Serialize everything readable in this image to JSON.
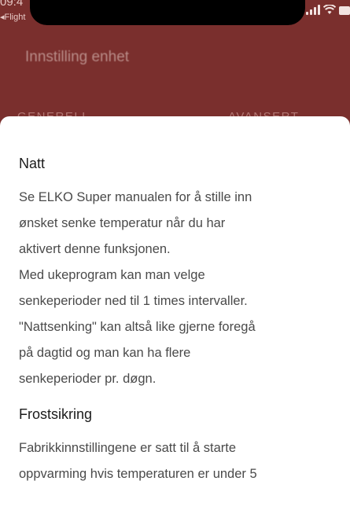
{
  "status_bar": {
    "time": "09:4",
    "carrier": "◂Flight",
    "signal_icon": "signal-icon",
    "wifi_icon": "wifi-icon",
    "battery_icon": "battery-icon"
  },
  "header": {
    "title": "Innstilling enhet"
  },
  "tabs": [
    {
      "label": "GENERELL"
    },
    {
      "label": "AVANSERT"
    }
  ],
  "sections": [
    {
      "heading": "Natt",
      "body": "Se ELKO Super manualen for å stille inn\nønsket senke temperatur når du har\naktivert denne funksjonen.\nMed ukeprogram kan man velge\nsenkeperioder ned til 1 times intervaller.\n\"Nattsenking\" kan altså like gjerne foregå\npå dagtid og man kan ha flere\nsenkeperioder pr. døgn."
    },
    {
      "heading": "Frostsikring",
      "body": "Fabrikkinnstillingene er satt til å starte\noppvarming hvis temperaturen er under 5"
    }
  ]
}
